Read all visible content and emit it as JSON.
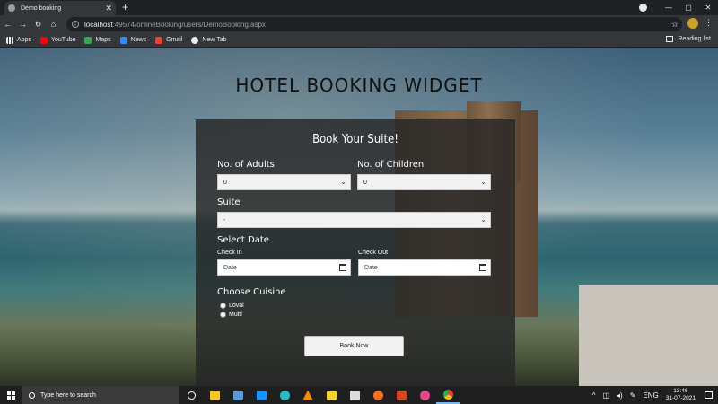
{
  "browser": {
    "tab_title": "Demo booking",
    "tab_close": "✕",
    "new_tab": "+",
    "url_host": "localhost",
    "url_rest": ":49574/onlineBooking/users/DemoBooking.aspx",
    "window_controls": [
      "—",
      "▢",
      "✕"
    ]
  },
  "bookmarks": [
    {
      "label": "Apps",
      "icon": "apps-grid-icon",
      "color": "#e8eaed"
    },
    {
      "label": "YouTube",
      "icon": "youtube-icon",
      "color": "#ff0000"
    },
    {
      "label": "Maps",
      "icon": "maps-icon",
      "color": "#34a853"
    },
    {
      "label": "News",
      "icon": "news-icon",
      "color": "#4285f4"
    },
    {
      "label": "Gmail",
      "icon": "gmail-icon",
      "color": "#ea4335"
    },
    {
      "label": "New Tab",
      "icon": "globe-icon",
      "color": "#e8eaed"
    }
  ],
  "reading_list": "Reading list",
  "page": {
    "title": "HOTEL BOOKING WIDGET"
  },
  "form": {
    "heading": "Book Your Suite!",
    "adults_label": "No. of Adults",
    "adults_value": "0",
    "children_label": "No. of Children",
    "children_value": "0",
    "suite_label": "Suite",
    "suite_value": "-",
    "date_label": "Select Date",
    "checkin_label": "Check In",
    "checkin_placeholder": "Date",
    "checkout_label": "Check Out",
    "checkout_placeholder": "Date",
    "cuisine_label": "Choose Cuisine",
    "cuisine_options": [
      "Loval",
      "Multi"
    ],
    "submit_label": "Book Now"
  },
  "taskbar": {
    "search_placeholder": "Type here to search",
    "language": "ENG",
    "time": "13:46",
    "date": "31-07-2021",
    "apps": [
      {
        "icon": "task-view-icon",
        "color": "#ffffff"
      },
      {
        "icon": "file-explorer-icon",
        "color": "#f4c430"
      },
      {
        "icon": "teams-icon",
        "color": "#5b9bd5"
      },
      {
        "icon": "mail-icon",
        "color": "#1e90ff"
      },
      {
        "icon": "edge-icon",
        "color": "#2fb7c9"
      },
      {
        "icon": "vlc-icon",
        "color": "#ff8800"
      },
      {
        "icon": "sticky-notes-icon",
        "color": "#f0d43a"
      },
      {
        "icon": "store-icon",
        "color": "#dddddd"
      },
      {
        "icon": "firefox-icon",
        "color": "#ff6d2a"
      },
      {
        "icon": "powerpoint-icon",
        "color": "#d24726"
      },
      {
        "icon": "media-icon",
        "color": "#e04a8a"
      },
      {
        "icon": "chrome-icon",
        "color": "#f4c20d"
      }
    ]
  }
}
